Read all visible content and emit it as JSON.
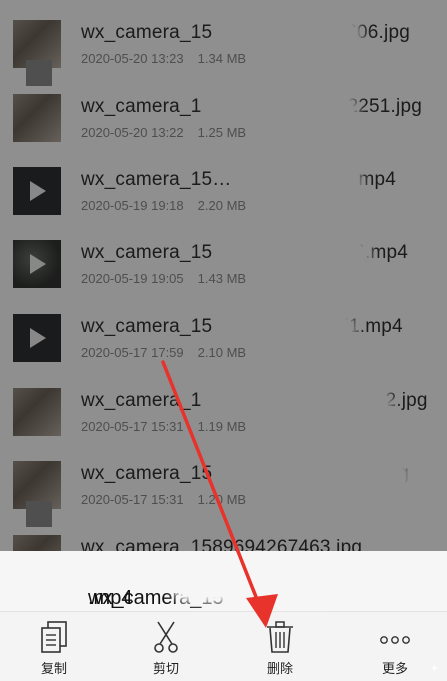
{
  "files": [
    {
      "name_start": "wx_camera_15",
      "name_end": "606.jpg",
      "date": "2020-05-20 13:23",
      "size": "1.34 MB",
      "kind": "photo"
    },
    {
      "name_start": "wx_camera_1",
      "name_end": "2251.jpg",
      "date": "2020-05-20 13:22",
      "size": "1.25 MB",
      "kind": "photo"
    },
    {
      "name_start": "wx_camera_15…",
      "name_end": "09.mp4",
      "date": "2020-05-19 19:18",
      "size": "2.20 MB",
      "kind": "video"
    },
    {
      "name_start": "wx_camera_15",
      "name_end": "4.mp4",
      "date": "2020-05-19 19:05",
      "size": "1.43 MB",
      "kind": "video"
    },
    {
      "name_start": "wx_camera_15",
      "name_end": "51.mp4",
      "date": "2020-05-17 17:59",
      "size": "2.10 MB",
      "kind": "video"
    },
    {
      "name_start": "wx_camera_1",
      "name_end": "2.jpg",
      "date": "2020-05-17 15:31",
      "size": "1.19 MB",
      "kind": "photo"
    },
    {
      "name_start": "wx_camera_15",
      "name_end": "g",
      "date": "2020-05-17 15:31",
      "size": "1.20 MB",
      "kind": "photo"
    },
    {
      "name_start": "wx_camera_1589694267463.jpg",
      "name_end": "",
      "date": "",
      "size": "",
      "kind": "photo"
    }
  ],
  "sheet": {
    "title_start": "wx_camera_15",
    "title_end": ".mp4"
  },
  "actions": [
    {
      "label": "复制",
      "icon": "copy-icon"
    },
    {
      "label": "剪切",
      "icon": "scissors-icon"
    },
    {
      "label": "删除",
      "icon": "trash-icon"
    },
    {
      "label": "更多",
      "icon": "more-icon"
    }
  ],
  "colors": {
    "arrow": "#e8322c",
    "overlay": "rgba(0,0,0,0.44)"
  }
}
